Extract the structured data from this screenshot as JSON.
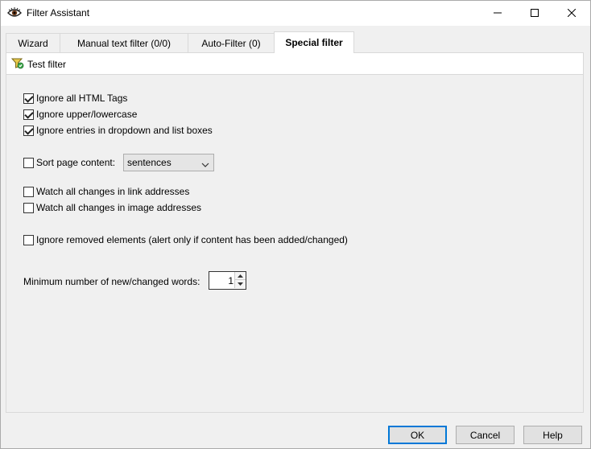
{
  "window": {
    "title": "Filter Assistant"
  },
  "tabs": [
    {
      "label": "Wizard"
    },
    {
      "label": "Manual text filter  (0/0)"
    },
    {
      "label": "Auto-Filter  (0)"
    },
    {
      "label": "Special filter"
    }
  ],
  "active_tab": "Special filter",
  "toolbar": {
    "test_filter_label": "Test filter"
  },
  "options": {
    "ignore_html": {
      "label": "Ignore all HTML Tags",
      "checked": true
    },
    "ignore_case": {
      "label": "Ignore upper/lowercase",
      "checked": true
    },
    "ignore_dropdown": {
      "label": "Ignore entries in dropdown and list boxes",
      "checked": true
    },
    "sort_content": {
      "label": "Sort page content:",
      "checked": false,
      "selected": "sentences"
    },
    "watch_links": {
      "label": "Watch all changes in link addresses",
      "checked": false
    },
    "watch_images": {
      "label": "Watch all changes in image addresses",
      "checked": false
    },
    "ignore_removed": {
      "label": "Ignore removed elements (alert only if content has been added/changed)",
      "checked": false
    }
  },
  "min_words": {
    "label": "Minimum number of new/changed words:",
    "value": "1"
  },
  "buttons": {
    "ok": "OK",
    "cancel": "Cancel",
    "help": "Help"
  },
  "icons": [
    "eye-icon",
    "minimize-icon",
    "maximize-icon",
    "close-icon",
    "filter-test-icon",
    "chevron-down-icon",
    "spin-up-icon",
    "spin-down-icon"
  ]
}
